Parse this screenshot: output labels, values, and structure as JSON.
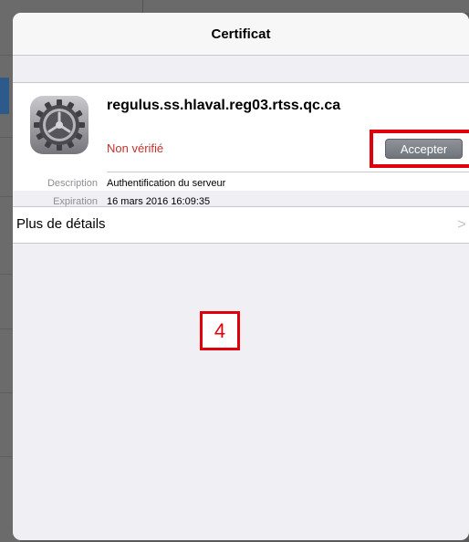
{
  "navbar": {
    "title": "Certificat"
  },
  "certificate": {
    "icon": "settings-gear-icon",
    "name": "regulus.ss.hlaval.reg03.rtss.qc.ca",
    "status": "Non vérifié",
    "accept_label": "Accepter"
  },
  "details": [
    {
      "label": "Description",
      "value": "Authentification du serveur"
    },
    {
      "label": "Expiration",
      "value": "16 mars 2016 16:09:35"
    }
  ],
  "more_details": {
    "label": "Plus de détails",
    "chevron": ">"
  },
  "annotation": {
    "step": "4"
  },
  "colors": {
    "status": "#c4322f",
    "highlight": "#e0000b",
    "accept_button": "#7f848a"
  }
}
